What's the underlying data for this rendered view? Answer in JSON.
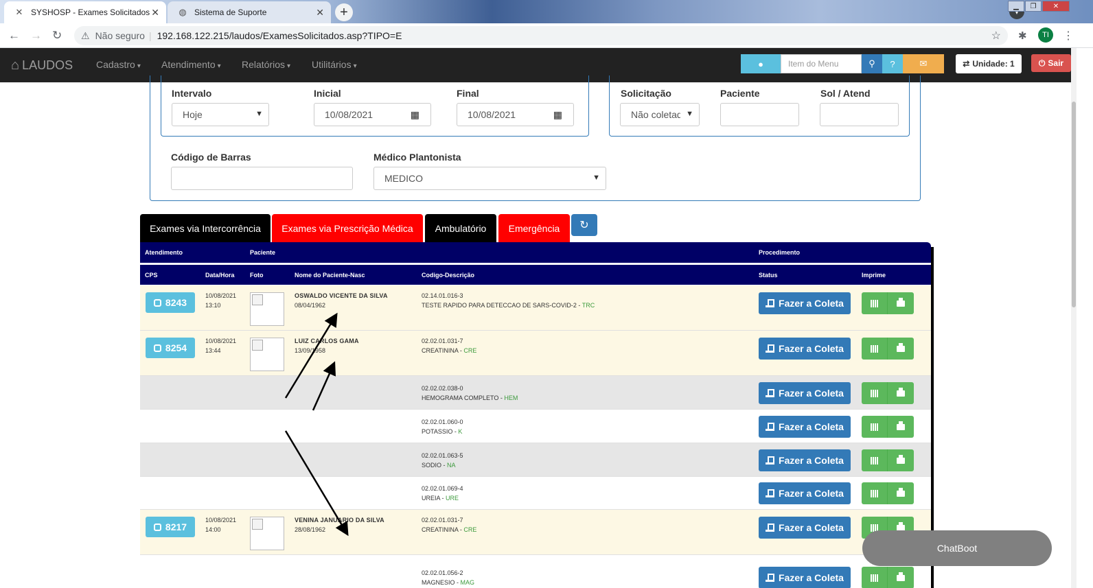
{
  "browser": {
    "tabs": [
      {
        "title": "SYSHOSP - Exames Solicitados",
        "active": true
      },
      {
        "title": "Sistema de Suporte",
        "active": false
      }
    ],
    "security_label": "Não seguro",
    "url": "192.168.122.215/laudos/ExamesSolicitados.asp?TIPO=E",
    "profile_initials": "TI"
  },
  "navbar": {
    "brand": "LAUDOS",
    "menus": [
      "Cadastro",
      "Atendimento",
      "Relatórios",
      "Utilitários"
    ],
    "search_placeholder": "Item do Menu",
    "unidade": "Unidade: 1",
    "sair": "Sair"
  },
  "filters": {
    "intervalo_label": "Intervalo",
    "intervalo_value": "Hoje",
    "inicial_label": "Inicial",
    "inicial_value": "10/08/2021",
    "final_label": "Final",
    "final_value": "10/08/2021",
    "solicitacao_label": "Solicitação",
    "solicitacao_value": "Não coletad",
    "paciente_label": "Paciente",
    "paciente_value": "",
    "sol_atend_label": "Sol / Atend",
    "sol_atend_value": "",
    "codigo_barras_label": "Código de Barras",
    "codigo_barras_value": "",
    "medico_label": "Médico Plantonista",
    "medico_value": "MEDICO"
  },
  "exam_tabs": [
    {
      "label": "Exames via Intercorrência",
      "color": "#000000"
    },
    {
      "label": "Exames via Prescrição Médica",
      "color": "#ff0000"
    },
    {
      "label": "Ambulatório",
      "color": "#000000"
    },
    {
      "label": "Emergência",
      "color": "#ff0000"
    }
  ],
  "table": {
    "group_headers": {
      "atendimento": "Atendimento",
      "paciente": "Paciente",
      "procedimento": "Procedimento"
    },
    "columns": {
      "cps": "CPS",
      "data": "Data/Hora",
      "foto": "Foto",
      "nome": "Nome do Paciente-Nasc",
      "codigo": "Codigo-Descrição",
      "status": "Status",
      "imprime": "Imprime"
    },
    "rows": [
      {
        "cps": "8243",
        "date": "10/08/2021",
        "time": "13:10",
        "name": "OSWALDO VICENTE DA SILVA",
        "birth": "08/04/1962",
        "code": "02.14.01.016-3",
        "desc": "TESTE RAPIDO PARA DETECCAO DE SARS-COVID-2 - ",
        "sigla": "TRC",
        "bg": "#fdf8e4"
      },
      {
        "cps": "8254",
        "date": "10/08/2021",
        "time": "13:44",
        "name": "LUIZ CARLOS GAMA",
        "birth": "13/09/1958",
        "code": "02.02.01.031-7",
        "desc": "CREATININA - ",
        "sigla": "CRE",
        "bg": "#fdf8e4"
      },
      {
        "cps": "",
        "date": "",
        "time": "",
        "name": "",
        "birth": "",
        "code": "02.02.02.038-0",
        "desc": "HEMOGRAMA COMPLETO - ",
        "sigla": "HEM",
        "bg": "#e6e6e6"
      },
      {
        "cps": "",
        "date": "",
        "time": "",
        "name": "",
        "birth": "",
        "code": "02.02.01.060-0",
        "desc": "POTASSIO - ",
        "sigla": "K",
        "bg": "#ffffff"
      },
      {
        "cps": "",
        "date": "",
        "time": "",
        "name": "",
        "birth": "",
        "code": "02.02.01.063-5",
        "desc": "SODIO - ",
        "sigla": "NA",
        "bg": "#e6e6e6"
      },
      {
        "cps": "",
        "date": "",
        "time": "",
        "name": "",
        "birth": "",
        "code": "02.02.01.069-4",
        "desc": "UREIA - ",
        "sigla": "URE",
        "bg": "#ffffff"
      },
      {
        "cps": "8217",
        "date": "10/08/2021",
        "time": "14:00",
        "name": "VENINA JANUARIO DA SILVA",
        "birth": "28/08/1962",
        "code": "02.02.01.031-7",
        "desc": "CREATININA - ",
        "sigla": "CRE",
        "bg": "#fdf8e4"
      },
      {
        "cps": "",
        "date": "",
        "time": "",
        "name": "",
        "birth": "",
        "code": "02.02.01.056-2",
        "desc": "MAGNESIO - ",
        "sigla": "MAG",
        "bg": "#ffffff"
      }
    ],
    "coleta_label": "Fazer a Coleta"
  },
  "chatbot_label": "ChatBoot",
  "colors": {
    "navy": "#000066",
    "primary": "#337ab7",
    "info": "#5bc0de",
    "success": "#5cb85c",
    "danger": "#d9534f",
    "warning": "#f0ad4e"
  }
}
